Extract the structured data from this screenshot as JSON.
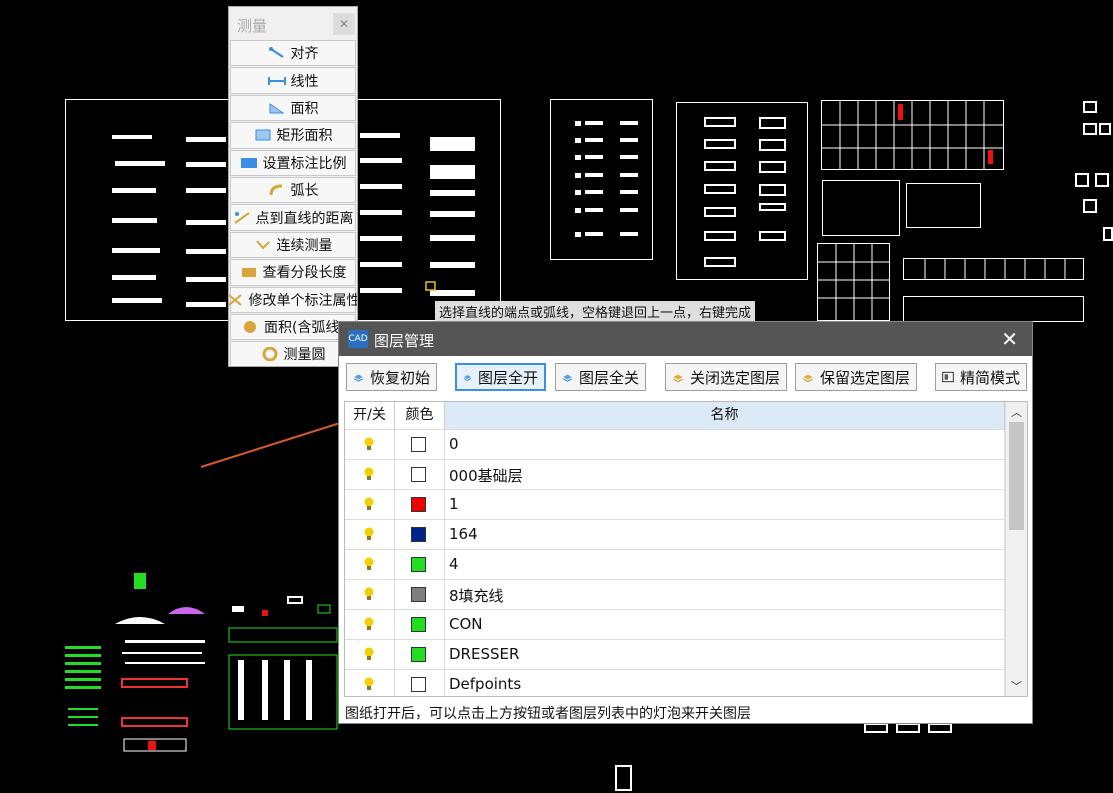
{
  "measure_panel": {
    "title": "测量",
    "close_icon": "close-icon",
    "items": [
      {
        "label": "对齐",
        "icon": "align-icon"
      },
      {
        "label": "线性",
        "icon": "linear-icon"
      },
      {
        "label": "面积",
        "icon": "area-icon"
      },
      {
        "label": "矩形面积",
        "icon": "rect-area-icon"
      },
      {
        "label": "设置标注比例",
        "icon": "scale-icon"
      },
      {
        "label": "弧长",
        "icon": "arc-length-icon"
      },
      {
        "label": "点到直线的距离",
        "icon": "point-line-icon"
      },
      {
        "label": "连续测量",
        "icon": "continuous-icon"
      },
      {
        "label": "查看分段长度",
        "icon": "segment-length-icon"
      },
      {
        "label": "修改单个标注属性",
        "icon": "edit-annotation-icon"
      },
      {
        "label": "面积(含弧线)",
        "icon": "arc-area-icon"
      },
      {
        "label": "测量圆",
        "icon": "circle-icon"
      }
    ]
  },
  "status_hint": "选择直线的端点或弧线，空格键退回上一点，右键完成",
  "layer_dialog": {
    "title": "图层管理",
    "logo_text": "CAD",
    "toolbar": {
      "restore": "恢复初始",
      "all_on": "图层全开",
      "all_off": "图层全关",
      "close_selected": "关闭选定图层",
      "keep_selected": "保留选定图层",
      "simple_mode": "精简模式"
    },
    "columns": {
      "toggle": "开/关",
      "color": "颜色",
      "name": "名称"
    },
    "layers": [
      {
        "name": "0",
        "color": "#ffffff",
        "on": true
      },
      {
        "name": "000基础层",
        "color": "#ffffff",
        "on": true
      },
      {
        "name": "1",
        "color": "#ee0000",
        "on": true
      },
      {
        "name": "164",
        "color": "#00228c",
        "on": true
      },
      {
        "name": "4",
        "color": "#22dd22",
        "on": true
      },
      {
        "name": "8填充线",
        "color": "#7f7f7f",
        "on": true
      },
      {
        "name": "CON",
        "color": "#22dd22",
        "on": true
      },
      {
        "name": "DRESSER",
        "color": "#22dd22",
        "on": true
      },
      {
        "name": "Defpoints",
        "color": "#ffffff",
        "on": true
      }
    ],
    "status": "图纸打开后，可以点击上方按钮或者图层列表中的灯泡来开关图层"
  },
  "colors": {
    "bulb": "#f2d000",
    "active_border": "#3a8ee6",
    "titlebar": "#555555"
  }
}
